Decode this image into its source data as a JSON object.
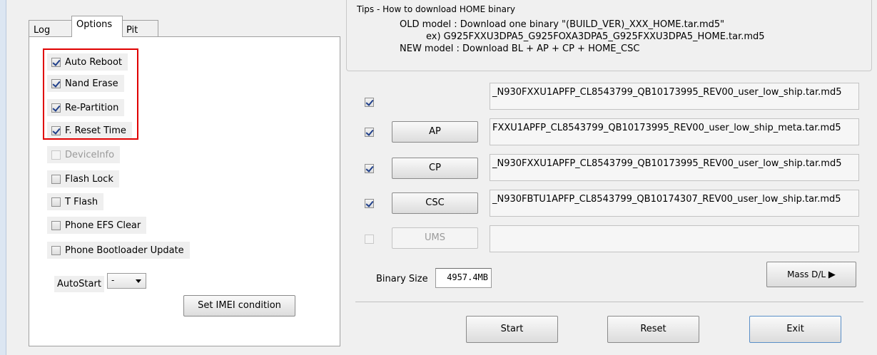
{
  "tabs": [
    {
      "label": "Log"
    },
    {
      "label": "Options"
    },
    {
      "label": "Pit"
    }
  ],
  "options": {
    "auto_reboot": {
      "label": "Auto Reboot",
      "checked": true
    },
    "nand_erase": {
      "label": "Nand Erase",
      "checked": true
    },
    "re_partition": {
      "label": "Re-Partition",
      "checked": true
    },
    "f_reset_time": {
      "label": "F. Reset Time",
      "checked": true
    },
    "device_info": {
      "label": "DeviceInfo",
      "checked": false,
      "disabled": true
    },
    "flash_lock": {
      "label": "Flash Lock",
      "checked": false
    },
    "t_flash": {
      "label": "T Flash",
      "checked": false
    },
    "phone_efs_clear": {
      "label": "Phone EFS Clear",
      "checked": false
    },
    "phone_bootloader_update": {
      "label": "Phone Bootloader Update",
      "checked": false
    },
    "autostart_label": "AutoStart",
    "autostart_value": "-",
    "set_imei_label": "Set IMEI condition",
    "highlight_color": "#e00000"
  },
  "tips": {
    "title": "Tips - How to download HOME binary",
    "line1": "OLD model  : Download one binary    \"(BUILD_VER)_XXX_HOME.tar.md5\"",
    "line2": "ex) G925FXXU3DPA5_G925FOXA3DPA5_G925FXXU3DPA5_HOME.tar.md5",
    "line3": "NEW model : Download BL + AP + CP + HOME_CSC"
  },
  "files": {
    "bl": {
      "label": "",
      "checked": true,
      "path": "_N930FXXU1APFP_CL8543799_QB10173995_REV00_user_low_ship.tar.md5"
    },
    "ap": {
      "label": "AP",
      "checked": true,
      "path": "FXXU1APFP_CL8543799_QB10173995_REV00_user_low_ship_meta.tar.md5"
    },
    "cp": {
      "label": "CP",
      "checked": true,
      "path": "_N930FXXU1APFP_CL8543799_QB10173995_REV00_user_low_ship.tar.md5"
    },
    "csc": {
      "label": "CSC",
      "checked": true,
      "path": "_N930FBTU1APFP_CL8543799_QB10174307_REV00_user_low_ship.tar.md5"
    },
    "ums": {
      "label": "UMS",
      "checked": false,
      "disabled": true,
      "path": ""
    }
  },
  "binary_size": {
    "label": "Binary Size",
    "value": "4957.4MB"
  },
  "mass_dl_label": "Mass D/L",
  "buttons": {
    "start": "Start",
    "reset": "Reset",
    "exit": "Exit"
  }
}
